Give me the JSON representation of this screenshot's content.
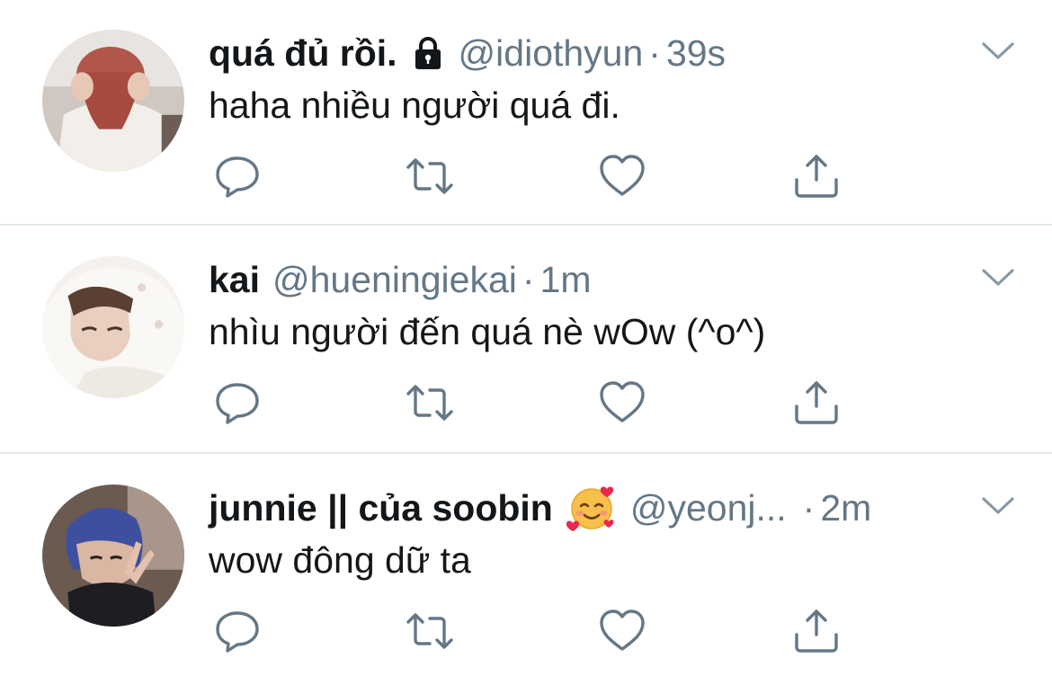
{
  "tweets": [
    {
      "name": "quá đủ rồi.",
      "protected_icon": "lock-icon",
      "handle": "@idiothyun",
      "separator": "·",
      "time": "39s",
      "text": "haha nhiều người quá đi.",
      "avatar": "avatar-photo"
    },
    {
      "name": "kai",
      "handle": "@hueningiekai",
      "separator": "·",
      "time": "1m",
      "text": "nhìu người đến quá nè wOw (^o^)",
      "avatar": "avatar-photo"
    },
    {
      "name": "junnie || của soobin",
      "emoji_icon": "smiling-face-with-hearts-icon",
      "handle": "@yeonj...",
      "separator": "·",
      "time": "2m",
      "text": "wow đông dữ ta",
      "avatar": "avatar-photo"
    }
  ],
  "actions": [
    "reply-icon",
    "retweet-icon",
    "like-icon",
    "share-icon"
  ],
  "colors": {
    "text": "#14171a",
    "secondary": "#657786",
    "icon": "#657786",
    "divider": "#e1e8ed",
    "background": "#ffffff"
  }
}
